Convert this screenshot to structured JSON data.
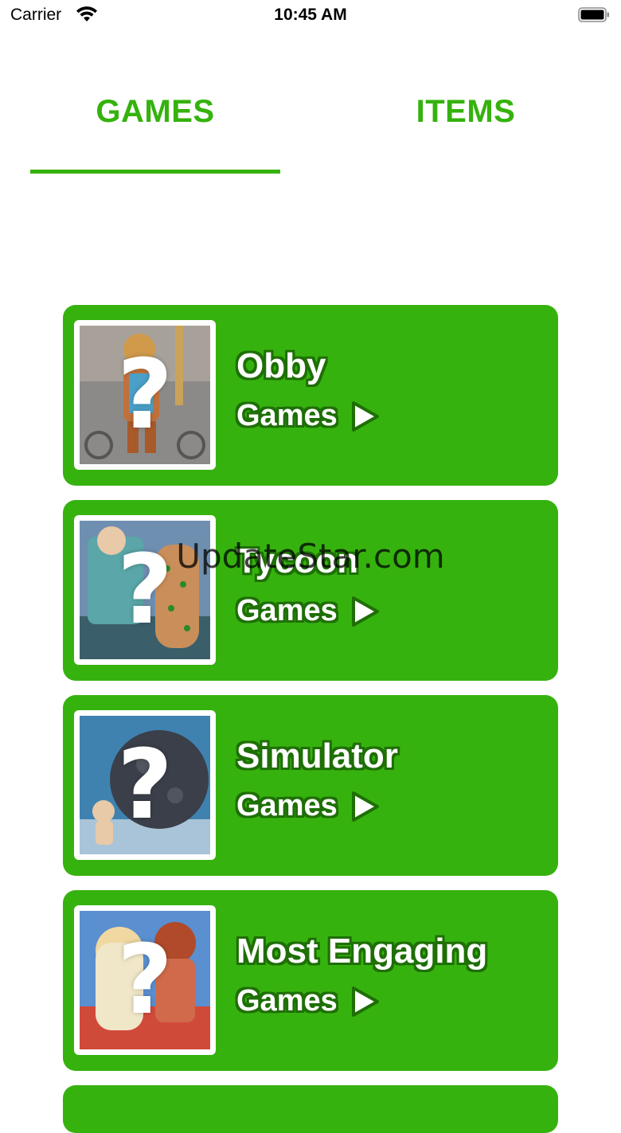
{
  "status_bar": {
    "carrier": "Carrier",
    "time": "10:45 AM"
  },
  "tabs": [
    {
      "label": "GAMES",
      "selected": true
    },
    {
      "label": "ITEMS",
      "selected": false
    }
  ],
  "colors": {
    "accent": "#35b20d",
    "card_bg": "#36b20e",
    "text_outline": "#1e6f06"
  },
  "cards": [
    {
      "title": "Obby",
      "subtitle": "Games",
      "thumb_icon": "question-mark-icon"
    },
    {
      "title": "Tycoon",
      "subtitle": "Games",
      "thumb_icon": "question-mark-icon"
    },
    {
      "title": "Simulator",
      "subtitle": "Games",
      "thumb_icon": "question-mark-icon"
    },
    {
      "title": "Most Engaging",
      "subtitle": "Games",
      "thumb_icon": "question-mark-icon"
    }
  ],
  "thumb_glyph": "?",
  "watermark": "UpdateStar.com"
}
